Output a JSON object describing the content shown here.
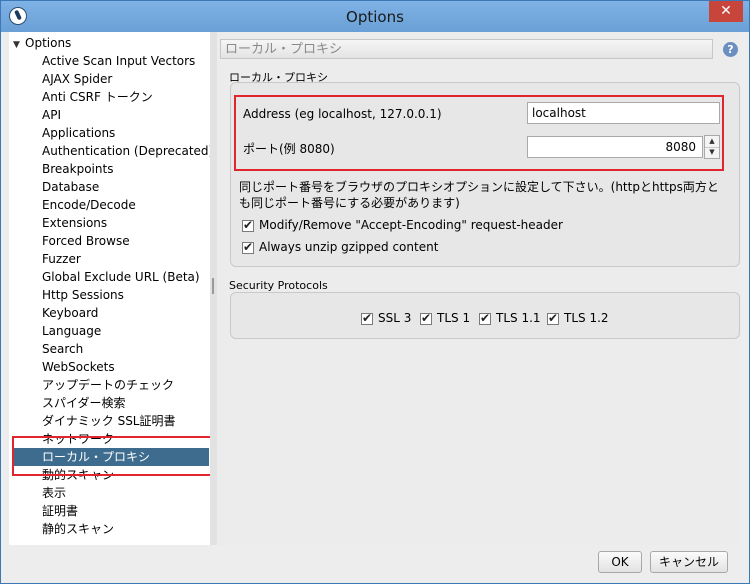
{
  "window": {
    "title": "Options",
    "close_symbol": "✕"
  },
  "tree": {
    "root": "Options",
    "root_arrow": "▼",
    "items": [
      "Active Scan Input Vectors",
      "AJAX Spider",
      "Anti CSRF トークン",
      "API",
      "Applications",
      "Authentication (Deprecated)",
      "Breakpoints",
      "Database",
      "Encode/Decode",
      "Extensions",
      "Forced Browse",
      "Fuzzer",
      "Global Exclude URL (Beta)",
      "Http Sessions",
      "Keyboard",
      "Language",
      "Search",
      "WebSockets",
      "アップデートのチェック",
      "スパイダー検索",
      "ダイナミック SSL証明書",
      "ネットワーク",
      "ローカル・プロキシ",
      "動的スキャン",
      "表示",
      "証明書",
      "静的スキャン"
    ],
    "selected": "ローカル・プロキシ"
  },
  "panel": {
    "header": "ローカル・プロキシ",
    "help_icon": "?",
    "section_title": "ローカル・プロキシ",
    "address_label": "Address (eg localhost, 127.0.0.1)",
    "address_value": "localhost",
    "port_label": "ポート(例 8080)",
    "port_value": "8080",
    "note_line1": "同じポート番号をブラウザのプロキシオプションに設定して下さい。(httpとhttps両方と",
    "note_line2": "も同じポート番号にする必要があります)",
    "check_modify": "Modify/Remove \"Accept-Encoding\" request-header",
    "check_unzip": "Always unzip gzipped content",
    "security_title": "Security Protocols",
    "protocols": [
      "SSL 3",
      "TLS 1",
      "TLS 1.1",
      "TLS 1.2"
    ]
  },
  "buttons": {
    "ok": "OK",
    "cancel": "キャンセル"
  },
  "colors": {
    "accent_highlight": "#e0252f",
    "selection": "#3d6c8f",
    "titlebar": "#6aa0d6"
  }
}
